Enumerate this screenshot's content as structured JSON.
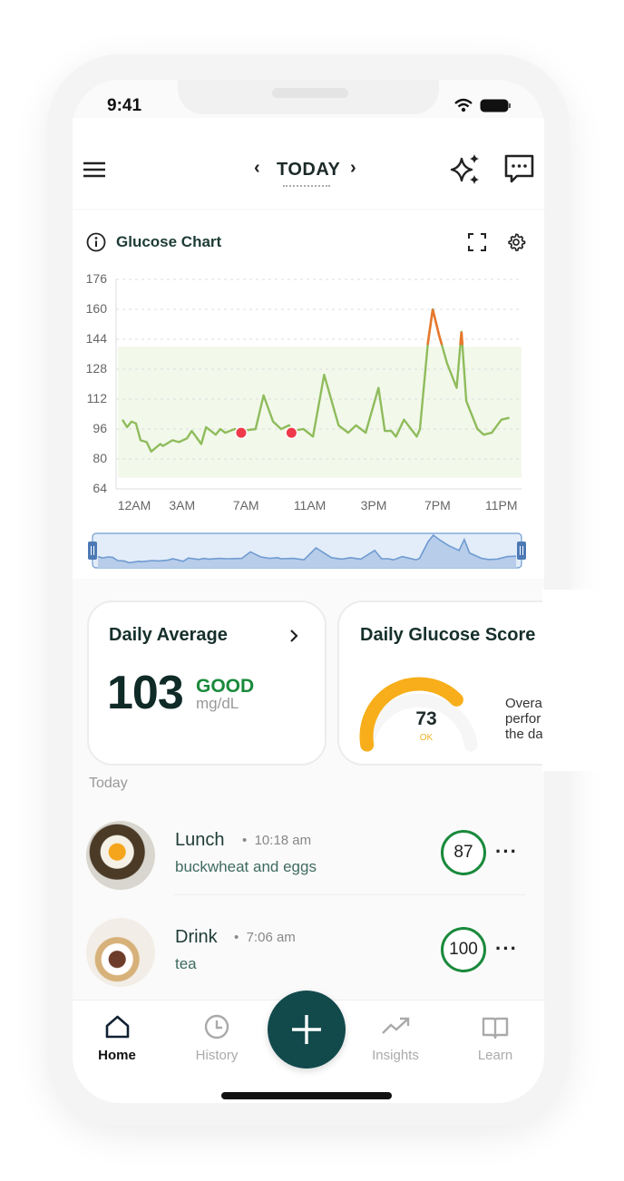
{
  "status_bar": {
    "time": "9:41"
  },
  "header": {
    "title": "TODAY",
    "prev": "‹",
    "next": "›"
  },
  "glucose_chart": {
    "title": "Glucose Chart"
  },
  "chart_data": {
    "type": "line",
    "title": "Glucose Chart",
    "y_ticks": [
      "176",
      "160",
      "144",
      "128",
      "112",
      "96",
      "80",
      "64"
    ],
    "x_ticks": [
      "12AM",
      "3AM",
      "7AM",
      "11AM",
      "3PM",
      "7PM",
      "11PM"
    ],
    "x_tick_hours": [
      0,
      3,
      7,
      11,
      15,
      19,
      23
    ],
    "ylim": [
      64,
      176
    ],
    "target_range": [
      70,
      140
    ],
    "high_threshold": 141,
    "colors": {
      "in_range": "#8fbc5c",
      "high": "#e8772e",
      "marker": "#ee3a4a",
      "band": "#f2f8ea",
      "navigator": "#6f9bd1"
    },
    "grid": true,
    "series": [
      {
        "x_hours": [
          -0.74,
          -0.45,
          -0.17,
          0.11,
          0.4,
          0.78,
          1.06,
          1.63,
          1.8,
          2.4,
          2.8,
          3.3,
          3.6,
          4.2,
          4.5,
          5.1,
          5.4,
          5.7,
          6.3,
          6.7,
          7.6,
          8.1,
          8.7,
          9.2,
          9.7,
          9.85,
          10.6,
          11.2,
          11.9,
          12.8,
          13.4,
          13.9,
          14.5,
          15.3,
          15.7,
          16.1,
          16.4,
          16.9,
          17.7,
          17.9,
          18.4,
          18.7,
          19.1,
          19.6,
          20.2,
          20.5,
          20.8,
          21.5,
          21.9,
          22.4,
          23.0,
          23.5
        ],
        "values": [
          101,
          97,
          100,
          99,
          90,
          89,
          84,
          88,
          87,
          90,
          89,
          91,
          95,
          88,
          97,
          93,
          96,
          94,
          96,
          95,
          96,
          114,
          100,
          96,
          98,
          95,
          96,
          92,
          125,
          98,
          94,
          98,
          94,
          118,
          95,
          95,
          92,
          101,
          92,
          96,
          142,
          160,
          146,
          131,
          118,
          148,
          111,
          96,
          93,
          94,
          101,
          102
        ]
      }
    ],
    "markers": [
      {
        "x_hours": 6.7,
        "value": 94
      },
      {
        "x_hours": 9.85,
        "value": 94
      }
    ]
  },
  "daily_average": {
    "title": "Daily Average",
    "value": "103",
    "status": "GOOD",
    "unit": "mg/dL"
  },
  "daily_score": {
    "title": "Daily Glucose Score",
    "value": "73",
    "rating": "OK",
    "score_fraction": 0.73,
    "desc_lines": [
      "Overa",
      "perfor",
      "the da"
    ]
  },
  "section_label": "Today",
  "entries": [
    {
      "title": "Lunch",
      "time": "10:18 am",
      "desc": "buckwheat and eggs",
      "score": "87"
    },
    {
      "title": "Drink",
      "time": "7:06 am",
      "desc": "tea",
      "score": "100"
    }
  ],
  "nav": {
    "items": [
      {
        "label": "Home",
        "active": true
      },
      {
        "label": "History"
      },
      {
        "label": "Insights"
      },
      {
        "label": "Learn"
      }
    ]
  }
}
